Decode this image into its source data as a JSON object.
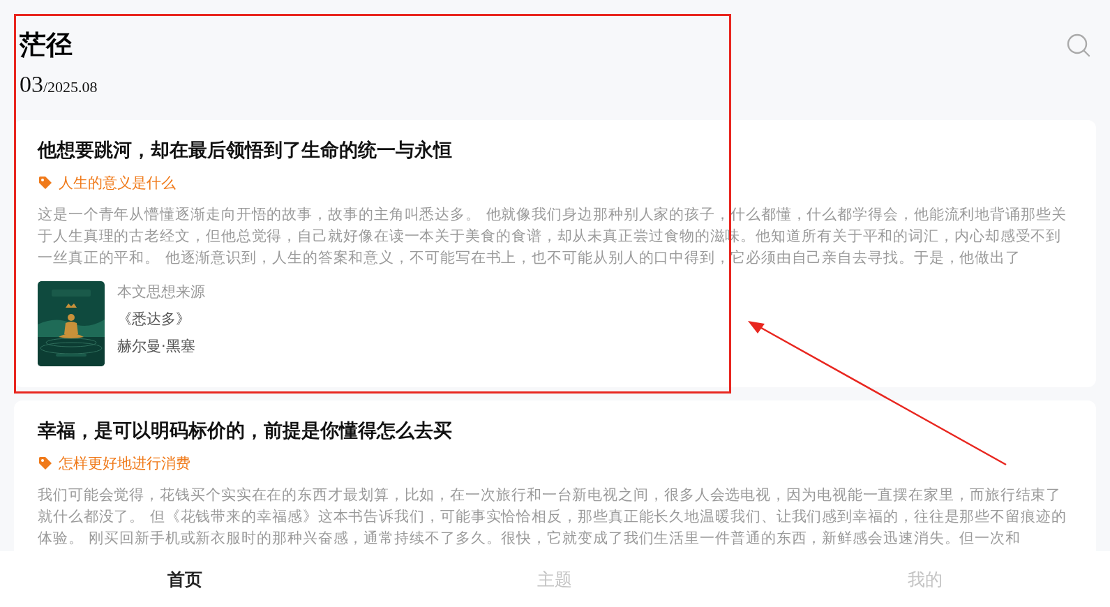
{
  "header": {
    "title": "茫径",
    "day": "03",
    "month_year": "/2025.08"
  },
  "articles": [
    {
      "title": "他想要跳河，却在最后领悟到了生命的统一与永恒",
      "tag": "人生的意义是什么",
      "excerpt": "这是一个青年从懵懂逐渐走向开悟的故事，故事的主角叫悉达多。 他就像我们身边那种别人家的孩子，什么都懂，什么都学得会，他能流利地背诵那些关于人生真理的古老经文，但他总觉得，自己就好像在读一本关于美食的食谱，却从未真正尝过食物的滋味。他知道所有关于平和的词汇，内心却感受不到一丝真正的平和。 他逐渐意识到，人生的答案和意义，不可能写在书上，也不可能从别人的口中得到，它必须由自己亲自去寻找。于是，他做出了",
      "source": {
        "label": "本文思想来源",
        "book": "《悉达多》",
        "author": "赫尔曼·黑塞"
      }
    },
    {
      "title": "幸福，是可以明码标价的，前提是你懂得怎么去买",
      "tag": "怎样更好地进行消费",
      "excerpt": "我们可能会觉得，花钱买个实实在在的东西才最划算，比如，在一次旅行和一台新电视之间，很多人会选电视，因为电视能一直摆在家里，而旅行结束了就什么都没了。 但《花钱带来的幸福感》这本书告诉我们，可能事实恰恰相反，那些真正能长久地温暖我们、让我们感到幸福的，往往是那些不留痕迹的体验。 刚买回新手机或新衣服时的那种兴奋感，通常持续不了多久。很快，它就变成了我们生活里一件普通的东西，新鲜感会迅速消失。但一次和"
    }
  ],
  "tabs": [
    {
      "label": "首页",
      "selected": true
    },
    {
      "label": "主题",
      "selected": false
    },
    {
      "label": "我的",
      "selected": false
    }
  ]
}
